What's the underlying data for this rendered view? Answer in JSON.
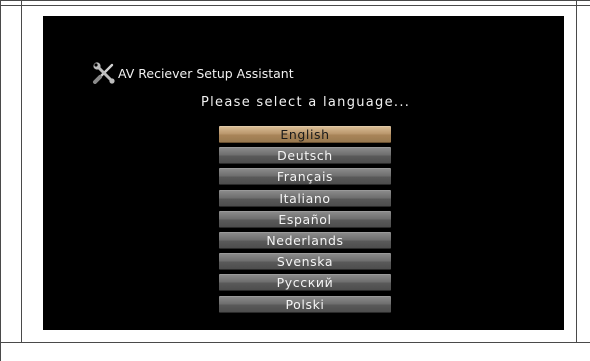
{
  "dialog": {
    "title": "AV Reciever Setup Assistant",
    "prompt": "Please select a language...",
    "icon": "tools-icon"
  },
  "languages": [
    {
      "label": "English",
      "selected": true
    },
    {
      "label": "Deutsch",
      "selected": false
    },
    {
      "label": "Français",
      "selected": false
    },
    {
      "label": "Italiano",
      "selected": false
    },
    {
      "label": "Español",
      "selected": false
    },
    {
      "label": "Nederlands",
      "selected": false
    },
    {
      "label": "Svenska",
      "selected": false
    },
    {
      "label": "Русский",
      "selected": false
    },
    {
      "label": "Polski",
      "selected": false
    }
  ],
  "colors": {
    "screen_background": "#000000",
    "selected_button": "#b8956a",
    "button": "#6d6d6d",
    "text": "#f2f2f2"
  }
}
